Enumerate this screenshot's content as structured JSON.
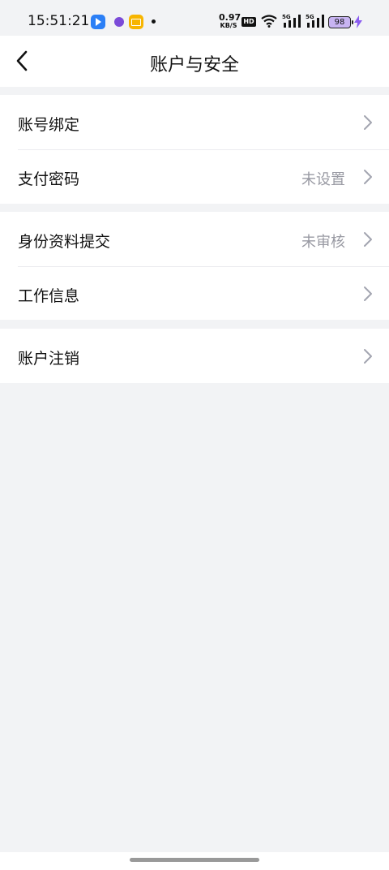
{
  "status_bar": {
    "time": "15:51:21",
    "net_speed_value": "0.97",
    "net_speed_unit": "KB/S",
    "hd_label": "HD",
    "signal1_label": "5G",
    "signal2_label": "5G",
    "battery_level": "98",
    "icons": [
      "app-blue-icon",
      "app-purple-icon",
      "mail-icon",
      "dot-icon",
      "wifi-icon",
      "signal-icon",
      "charging-icon"
    ]
  },
  "header": {
    "title": "账户与安全",
    "back_icon": "chevron-left-icon"
  },
  "groups": [
    {
      "rows": [
        {
          "label": "账号绑定",
          "value": ""
        },
        {
          "label": "支付密码",
          "value": "未设置"
        }
      ]
    },
    {
      "rows": [
        {
          "label": "身份资料提交",
          "value": "未审核"
        },
        {
          "label": "工作信息",
          "value": ""
        }
      ]
    },
    {
      "rows": [
        {
          "label": "账户注销",
          "value": ""
        }
      ]
    }
  ],
  "colors": {
    "background": "#f2f3f5",
    "card": "#ffffff",
    "secondary_text": "#999aa3",
    "battery_fill": "#c8b4f2",
    "bolt": "#8a5cf0"
  }
}
